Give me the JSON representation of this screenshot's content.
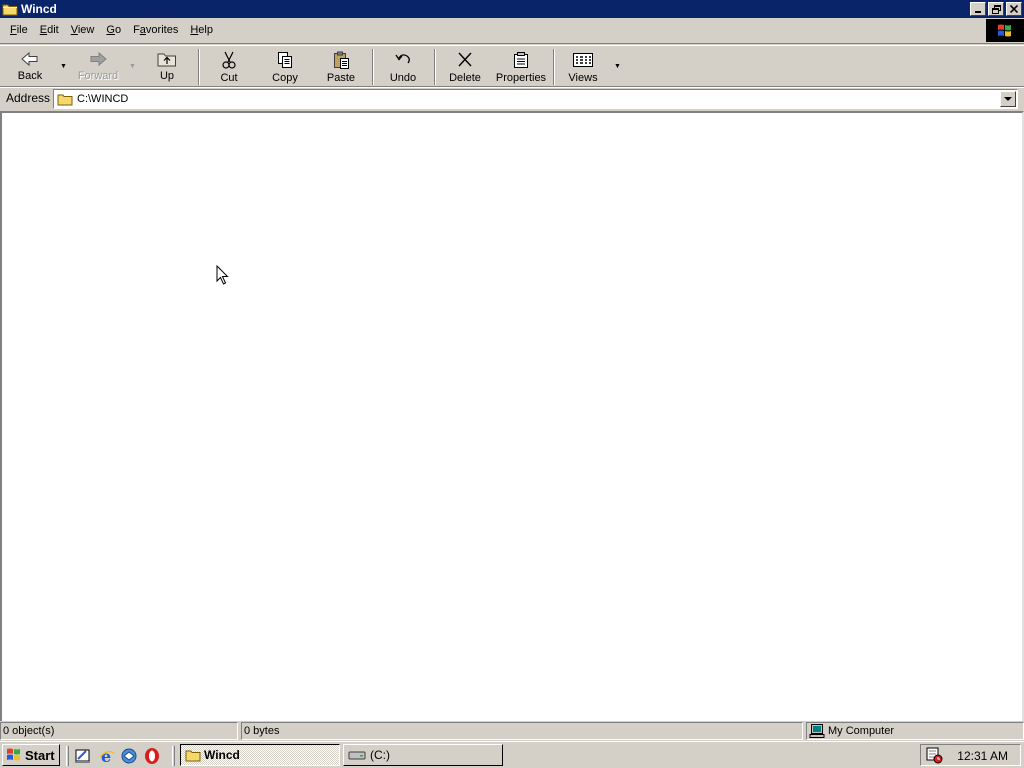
{
  "window": {
    "title": "Wincd",
    "icons": {
      "folder": "folder-icon",
      "minimize": "minimize-icon",
      "restore": "restore-icon",
      "close": "close-icon"
    }
  },
  "menu": {
    "items": [
      {
        "label": "File",
        "accel": "F",
        "rest": "ile"
      },
      {
        "label": "Edit",
        "accel": "E",
        "rest": "dit"
      },
      {
        "label": "View",
        "accel": "V",
        "rest": "iew"
      },
      {
        "label": "Go",
        "accel": "G",
        "rest": "o"
      },
      {
        "label": "Favorites",
        "accel": "F",
        "rest": "avorites",
        "accel_pos": 1
      },
      {
        "label": "Help",
        "accel": "H",
        "rest": "elp"
      }
    ]
  },
  "toolbar": {
    "back": "Back",
    "forward": "Forward",
    "up": "Up",
    "cut": "Cut",
    "copy": "Copy",
    "paste": "Paste",
    "undo": "Undo",
    "delete": "Delete",
    "properties": "Properties",
    "views": "Views"
  },
  "address": {
    "label": "Address",
    "value": "C:\\WINCD"
  },
  "status": {
    "objects": "0 object(s)",
    "bytes": "0 bytes",
    "zone": "My Computer"
  },
  "taskbar": {
    "start_label": "Start",
    "tasks": [
      {
        "label": "Wincd",
        "active": true
      },
      {
        "label": "(C:)",
        "active": false
      }
    ],
    "clock": "12:31 AM"
  },
  "colors": {
    "titlebar": "#0a246a",
    "face": "#d4d0c8",
    "content": "#ffffff"
  }
}
